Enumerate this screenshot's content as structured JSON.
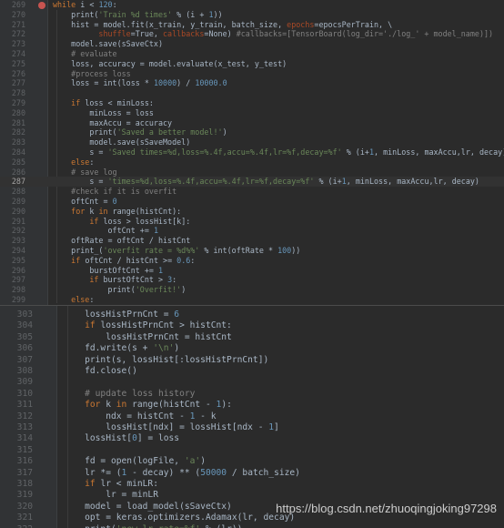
{
  "top_pane": {
    "lines": [
      {
        "no": "269",
        "tokens": [
          {
            "t": "while ",
            "c": "k"
          },
          {
            "t": "i",
            "c": ""
          },
          {
            "t": " < ",
            "c": ""
          },
          {
            "t": "120",
            "c": "n"
          },
          {
            "t": ":",
            "c": ""
          }
        ]
      },
      {
        "no": "270",
        "tokens": [
          {
            "t": "    print(",
            "c": ""
          },
          {
            "t": "'Train %d times'",
            "c": "s"
          },
          {
            "t": " % (i + ",
            "c": ""
          },
          {
            "t": "1",
            "c": "n"
          },
          {
            "t": "))",
            "c": ""
          }
        ]
      },
      {
        "no": "271",
        "tokens": [
          {
            "t": "    hist = model.fit(x_train, y_train, batch_size, ",
            "c": ""
          },
          {
            "t": "epochs",
            "c": "p"
          },
          {
            "t": "=epocsPerTrain, \\",
            "c": ""
          }
        ]
      },
      {
        "no": "272",
        "tokens": [
          {
            "t": "          ",
            "c": ""
          },
          {
            "t": "shuffle",
            "c": "p"
          },
          {
            "t": "=True, ",
            "c": ""
          },
          {
            "t": "callbacks",
            "c": "p"
          },
          {
            "t": "=None) ",
            "c": ""
          },
          {
            "t": "#callbacks=[TensorBoard(log_dir='./log_' + model_name)])",
            "c": "c"
          }
        ]
      },
      {
        "no": "273",
        "tokens": [
          {
            "t": "    model.save(sSaveCtx)",
            "c": ""
          }
        ]
      },
      {
        "no": "274",
        "tokens": [
          {
            "t": "    # evaluate",
            "c": "c"
          }
        ]
      },
      {
        "no": "275",
        "tokens": [
          {
            "t": "    loss, accuracy = model.evaluate(x_test, y_test)",
            "c": ""
          }
        ]
      },
      {
        "no": "276",
        "tokens": [
          {
            "t": "    #process loss",
            "c": "c"
          }
        ]
      },
      {
        "no": "277",
        "tokens": [
          {
            "t": "    loss = int(loss * ",
            "c": ""
          },
          {
            "t": "10000",
            "c": "n"
          },
          {
            "t": ") / ",
            "c": ""
          },
          {
            "t": "10000.0",
            "c": "n"
          }
        ]
      },
      {
        "no": "278",
        "tokens": [
          {
            "t": "",
            "c": ""
          }
        ]
      },
      {
        "no": "279",
        "tokens": [
          {
            "t": "    ",
            "c": ""
          },
          {
            "t": "if ",
            "c": "k"
          },
          {
            "t": "loss < minLoss:",
            "c": ""
          }
        ]
      },
      {
        "no": "280",
        "tokens": [
          {
            "t": "        minLoss = loss",
            "c": ""
          }
        ]
      },
      {
        "no": "281",
        "tokens": [
          {
            "t": "        maxAccu = accuracy",
            "c": ""
          }
        ]
      },
      {
        "no": "282",
        "tokens": [
          {
            "t": "        print(",
            "c": ""
          },
          {
            "t": "'Saved a better model!'",
            "c": "s"
          },
          {
            "t": ")",
            "c": ""
          }
        ]
      },
      {
        "no": "283",
        "tokens": [
          {
            "t": "        model.save(sSaveModel)",
            "c": ""
          }
        ]
      },
      {
        "no": "284",
        "tokens": [
          {
            "t": "        s = ",
            "c": ""
          },
          {
            "t": "'Saved times=%d,loss=%.4f,accu=%.4f,lr=%f,decay=%f'",
            "c": "s"
          },
          {
            "t": " % (i+",
            "c": ""
          },
          {
            "t": "1",
            "c": "n"
          },
          {
            "t": ", minLoss, maxAccu,lr, decay)",
            "c": ""
          }
        ]
      },
      {
        "no": "285",
        "tokens": [
          {
            "t": "    ",
            "c": ""
          },
          {
            "t": "else",
            "c": "k"
          },
          {
            "t": ":",
            "c": ""
          }
        ]
      },
      {
        "no": "286",
        "tokens": [
          {
            "t": "    # save log",
            "c": "c"
          }
        ]
      },
      {
        "no": "287",
        "active": true,
        "tokens": [
          {
            "t": "        s = ",
            "c": ""
          },
          {
            "t": "'times=%d,loss=%.4f,accu=%.4f,lr=%f,decay=%f'",
            "c": "s"
          },
          {
            "t": " % (i+",
            "c": ""
          },
          {
            "t": "1",
            "c": "n"
          },
          {
            "t": ", minLoss, maxAccu,lr, decay)",
            "c": ""
          }
        ]
      },
      {
        "no": "288",
        "tokens": [
          {
            "t": "    #check if it is overfit",
            "c": "c"
          }
        ]
      },
      {
        "no": "289",
        "tokens": [
          {
            "t": "    oftCnt = ",
            "c": ""
          },
          {
            "t": "0",
            "c": "n"
          }
        ]
      },
      {
        "no": "290",
        "tokens": [
          {
            "t": "    ",
            "c": ""
          },
          {
            "t": "for ",
            "c": "k"
          },
          {
            "t": "k ",
            "c": ""
          },
          {
            "t": "in ",
            "c": "k"
          },
          {
            "t": "range(histCnt):",
            "c": ""
          }
        ]
      },
      {
        "no": "291",
        "tokens": [
          {
            "t": "        ",
            "c": ""
          },
          {
            "t": "if ",
            "c": "k"
          },
          {
            "t": "loss > lossHist[k]:",
            "c": ""
          }
        ]
      },
      {
        "no": "292",
        "tokens": [
          {
            "t": "            oftCnt += ",
            "c": ""
          },
          {
            "t": "1",
            "c": "n"
          }
        ]
      },
      {
        "no": "293",
        "tokens": [
          {
            "t": "    oftRate = oftCnt / histCnt",
            "c": ""
          }
        ]
      },
      {
        "no": "294",
        "tokens": [
          {
            "t": "    print_(",
            "c": ""
          },
          {
            "t": "'overfit rate = %d%%'",
            "c": "s"
          },
          {
            "t": " % int(oftRate * ",
            "c": ""
          },
          {
            "t": "100",
            "c": "n"
          },
          {
            "t": "))",
            "c": ""
          }
        ]
      },
      {
        "no": "295",
        "tokens": [
          {
            "t": "    ",
            "c": ""
          },
          {
            "t": "if ",
            "c": "k"
          },
          {
            "t": "oftCnt / histCnt >= ",
            "c": ""
          },
          {
            "t": "0.6",
            "c": "n"
          },
          {
            "t": ":",
            "c": ""
          }
        ]
      },
      {
        "no": "296",
        "tokens": [
          {
            "t": "        burstOftCnt += ",
            "c": ""
          },
          {
            "t": "1",
            "c": "n"
          }
        ]
      },
      {
        "no": "297",
        "tokens": [
          {
            "t": "        ",
            "c": ""
          },
          {
            "t": "if ",
            "c": "k"
          },
          {
            "t": "burstOftCnt > ",
            "c": ""
          },
          {
            "t": "3",
            "c": "n"
          },
          {
            "t": ":",
            "c": ""
          }
        ]
      },
      {
        "no": "298",
        "tokens": [
          {
            "t": "            print(",
            "c": ""
          },
          {
            "t": "'Overfit!'",
            "c": "s"
          },
          {
            "t": ")",
            "c": ""
          }
        ]
      },
      {
        "no": "299",
        "tokens": [
          {
            "t": "    ",
            "c": ""
          },
          {
            "t": "else",
            "c": "k"
          },
          {
            "t": ":",
            "c": ""
          }
        ]
      }
    ]
  },
  "bottom_pane": {
    "lines": [
      {
        "no": "303",
        "tokens": [
          {
            "t": "    lossHistPrnCnt = ",
            "c": ""
          },
          {
            "t": "6",
            "c": "n"
          }
        ]
      },
      {
        "no": "304",
        "tokens": [
          {
            "t": "    ",
            "c": ""
          },
          {
            "t": "if ",
            "c": "k"
          },
          {
            "t": "lossHistPrnCnt > histCnt:",
            "c": ""
          }
        ]
      },
      {
        "no": "305",
        "tokens": [
          {
            "t": "        lossHistPrnCnt = histCnt",
            "c": ""
          }
        ]
      },
      {
        "no": "306",
        "tokens": [
          {
            "t": "    fd.write(s + ",
            "c": ""
          },
          {
            "t": "'\\n'",
            "c": "s"
          },
          {
            "t": ")",
            "c": ""
          }
        ]
      },
      {
        "no": "307",
        "tokens": [
          {
            "t": "    print(s, lossHist[:lossHistPrnCnt])",
            "c": ""
          }
        ]
      },
      {
        "no": "308",
        "tokens": [
          {
            "t": "    fd.close()",
            "c": ""
          }
        ]
      },
      {
        "no": "309",
        "tokens": [
          {
            "t": "",
            "c": ""
          }
        ]
      },
      {
        "no": "310",
        "tokens": [
          {
            "t": "    # update loss history",
            "c": "c"
          }
        ]
      },
      {
        "no": "311",
        "tokens": [
          {
            "t": "    ",
            "c": ""
          },
          {
            "t": "for ",
            "c": "k"
          },
          {
            "t": "k ",
            "c": ""
          },
          {
            "t": "in ",
            "c": "k"
          },
          {
            "t": "range(histCnt - ",
            "c": ""
          },
          {
            "t": "1",
            "c": "n"
          },
          {
            "t": "):",
            "c": ""
          }
        ]
      },
      {
        "no": "312",
        "tokens": [
          {
            "t": "        ndx = histCnt - ",
            "c": ""
          },
          {
            "t": "1",
            "c": "n"
          },
          {
            "t": " - k",
            "c": ""
          }
        ]
      },
      {
        "no": "313",
        "tokens": [
          {
            "t": "        lossHist[ndx] = lossHist[ndx - ",
            "c": ""
          },
          {
            "t": "1",
            "c": "n"
          },
          {
            "t": "]",
            "c": ""
          }
        ]
      },
      {
        "no": "314",
        "tokens": [
          {
            "t": "    lossHist[",
            "c": ""
          },
          {
            "t": "0",
            "c": "n"
          },
          {
            "t": "] = loss",
            "c": ""
          }
        ]
      },
      {
        "no": "315",
        "tokens": [
          {
            "t": "",
            "c": ""
          }
        ]
      },
      {
        "no": "316",
        "tokens": [
          {
            "t": "    fd = open(logFile, ",
            "c": ""
          },
          {
            "t": "'a'",
            "c": "s"
          },
          {
            "t": ")",
            "c": ""
          }
        ]
      },
      {
        "no": "317",
        "tokens": [
          {
            "t": "    lr *= (",
            "c": ""
          },
          {
            "t": "1",
            "c": "n"
          },
          {
            "t": " - decay) ** (",
            "c": ""
          },
          {
            "t": "50000",
            "c": "n"
          },
          {
            "t": " / batch_size)",
            "c": ""
          }
        ]
      },
      {
        "no": "318",
        "tokens": [
          {
            "t": "    ",
            "c": ""
          },
          {
            "t": "if ",
            "c": "k"
          },
          {
            "t": "lr < minLR:",
            "c": ""
          }
        ]
      },
      {
        "no": "319",
        "tokens": [
          {
            "t": "        lr = minLR",
            "c": ""
          }
        ]
      },
      {
        "no": "320",
        "tokens": [
          {
            "t": "    model = load_model(sSaveCtx)",
            "c": ""
          }
        ]
      },
      {
        "no": "321",
        "tokens": [
          {
            "t": "    opt = keras.optimizers.Adamax(lr, decay)",
            "c": ""
          }
        ]
      },
      {
        "no": "322",
        "tokens": [
          {
            "t": "    print(",
            "c": ""
          },
          {
            "t": "'new lr rate=%f'",
            "c": "s"
          },
          {
            "t": " % (lr))",
            "c": ""
          }
        ]
      }
    ]
  },
  "watermark": "https://blog.csdn.net/zhuoqingjoking97298"
}
